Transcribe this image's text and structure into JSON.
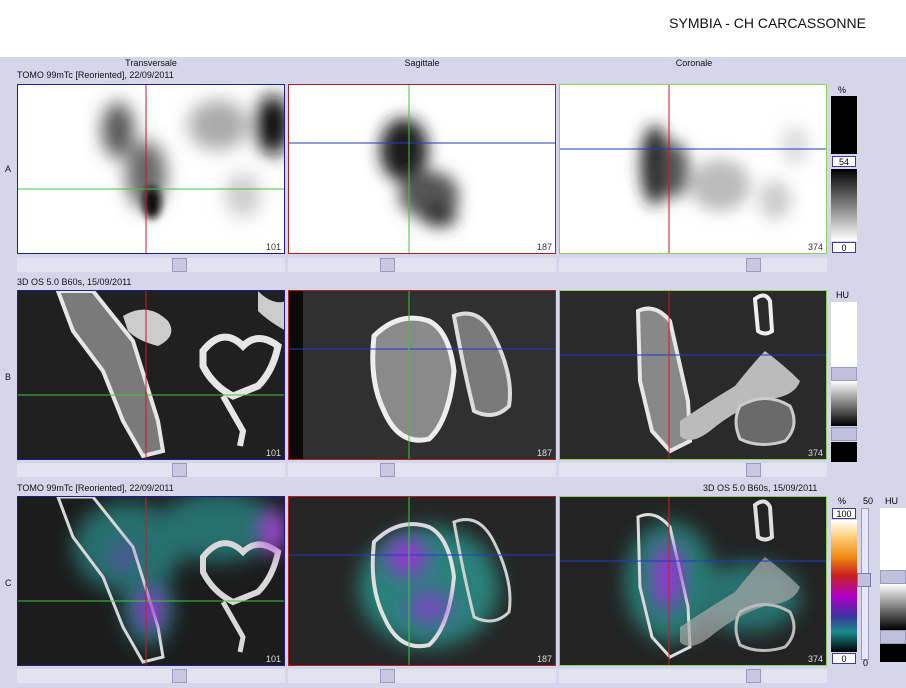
{
  "header": {
    "title": "SYMBIA - CH CARCASSONNE"
  },
  "columns": {
    "transverse": "Transversale",
    "sagittal": "Sagittale",
    "coronal": "Coronale"
  },
  "rows": {
    "a": {
      "letter": "A",
      "series": "TOMO 99mTc [Reoriented], 22/09/2011"
    },
    "b": {
      "letter": "B",
      "series": "3D  OS  5.0  B60s, 15/09/2011"
    },
    "c": {
      "letter": "C",
      "series_left": "TOMO 99mTc [Reoriented], 22/09/2011",
      "series_right": "3D  OS  5.0  B60s, 15/09/2011"
    }
  },
  "slices": {
    "transverse": "101",
    "sagittal": "187",
    "coronal": "374"
  },
  "colorbars": {
    "a": {
      "unit": "%",
      "value": "54",
      "min": "0"
    },
    "b": {
      "unit": "HU"
    },
    "c": {
      "unit": "%",
      "max": "100",
      "min": "0",
      "alpha": "50",
      "alpha_min": "0",
      "ct_unit": "HU"
    }
  },
  "colors": {
    "transverse": "#1e1e8c",
    "sagittal": "#b41e1e",
    "coronal": "#8cd25a",
    "crosshair_h_transverse": "#3cc83c",
    "crosshair_h": "#1e3cc8",
    "crosshair_v": "#c81e1e",
    "crosshair_v_green": "#3cc83c"
  }
}
